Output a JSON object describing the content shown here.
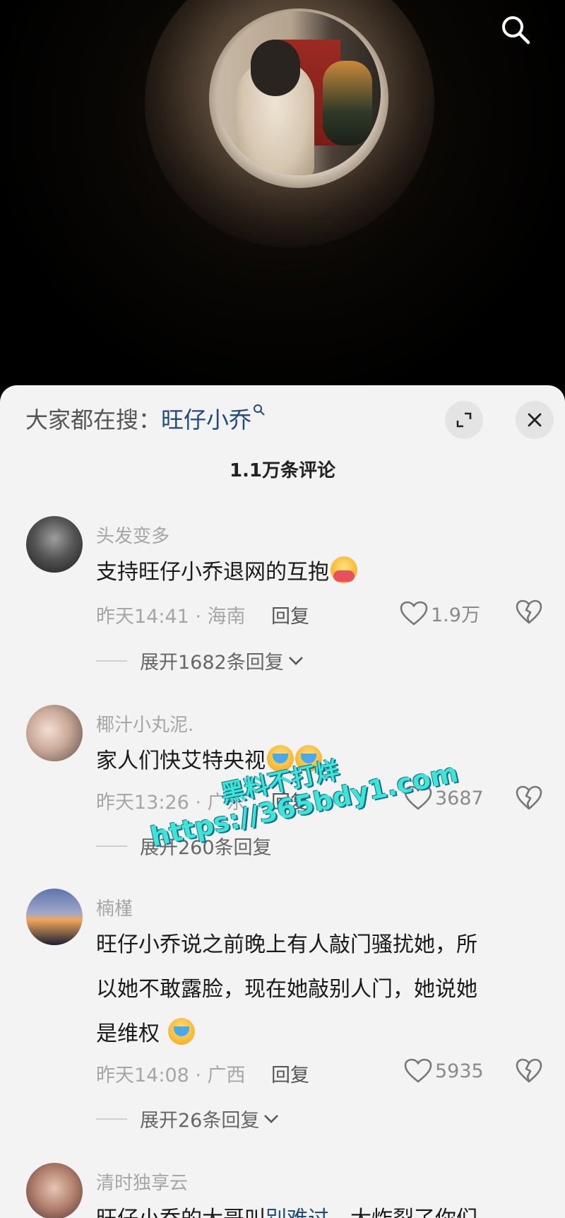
{
  "search": {
    "prefix": "大家都在搜：",
    "term": "旺仔小乔"
  },
  "comment_count": "1.1万条评论",
  "comments": [
    {
      "user": "头发变多",
      "text": "支持旺仔小乔退网的互抱",
      "time_location": "昨天14:41 · 海南",
      "reply_label": "回复",
      "likes": "1.9万",
      "expand_label": "展开1682条回复"
    },
    {
      "user": "椰汁小丸泥.",
      "text": "家人们快艾特央视",
      "time_location": "昨天13:26 · 广东",
      "reply_label": "回复",
      "likes": "3687",
      "expand_label": "展开260条回复"
    },
    {
      "user": "楠槿",
      "text_lines": [
        "旺仔小乔说之前晚上有人敲门骚扰她，所",
        "以她不敢露脸，现在她敲别人门，她说她",
        "是维权"
      ],
      "time_location": "昨天14:08 · 广西",
      "reply_label": "回复",
      "likes": "5935",
      "expand_label": "展开26条回复"
    },
    {
      "user": "清时独享云",
      "text_start": "旺仔小乔的大哥叫",
      "text_link": "别难过",
      "text_end": "，大炸裂了你们"
    }
  ],
  "watermark": {
    "line1": "黑料不打烊",
    "line2": "https://365bdy1.com"
  },
  "colors": {
    "panel_bg": "#f3f3f3",
    "search_link": "#1f4a7a",
    "meta_gray": "#a6a6a6",
    "watermark": "#3fe4d4"
  }
}
